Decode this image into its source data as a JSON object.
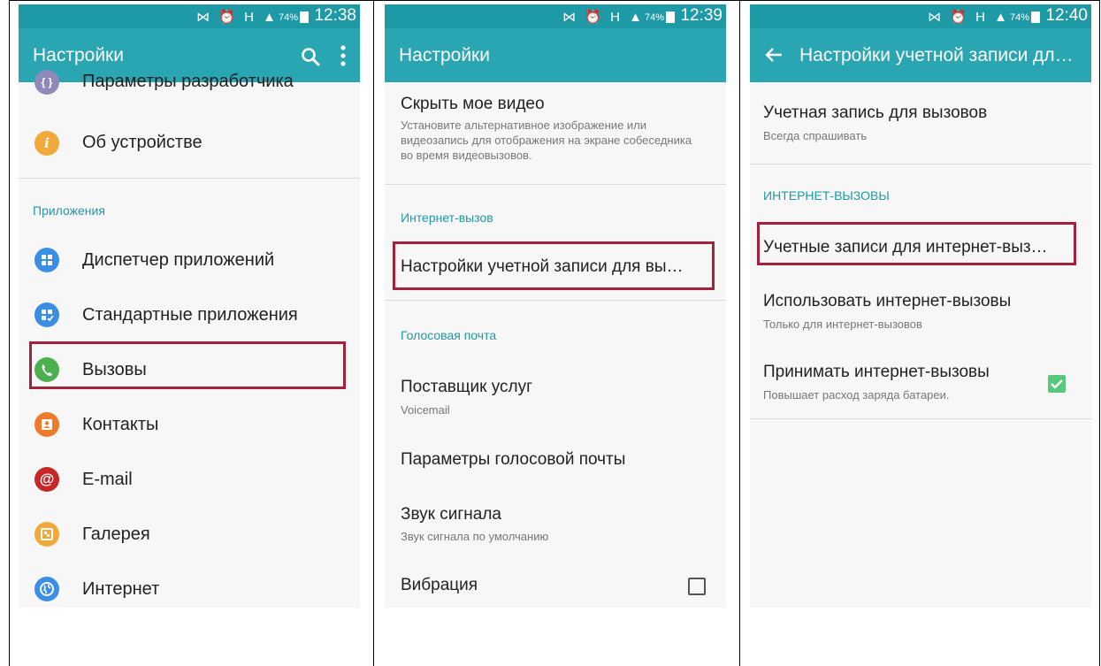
{
  "phone1": {
    "status": {
      "icons": "⋈ ⏰ H ▲",
      "battery": "74%",
      "time": "12:38"
    },
    "title": "Настройки",
    "top_partial_item": "Параметры разработчика",
    "about_item": "Об устройстве",
    "section": "Приложения",
    "items": [
      {
        "label": "Диспетчер приложений",
        "icon": "grid-icon",
        "color": "#3a8ee6"
      },
      {
        "label": "Стандартные приложения",
        "icon": "default-apps-icon",
        "color": "#3a8ee6"
      },
      {
        "label": "Вызовы",
        "icon": "phone-icon",
        "color": "#4caf50"
      },
      {
        "label": "Контакты",
        "icon": "contacts-icon",
        "color": "#f07a2c"
      },
      {
        "label": "E-mail",
        "icon": "email-icon",
        "color": "#c62828"
      },
      {
        "label": "Галерея",
        "icon": "gallery-icon",
        "color": "#f2a93b"
      },
      {
        "label": "Интернет",
        "icon": "globe-icon",
        "color": "#3a8ee6"
      }
    ]
  },
  "phone2": {
    "status": {
      "icons": "⋈ ⏰ H ▲",
      "battery": "74%",
      "time": "12:39"
    },
    "title": "Настройки",
    "hide_video": {
      "title": "Скрыть мое видео",
      "sub": "Установите альтернативное изображение или видеозапись для отображения на экране собеседника во время видеовызовов."
    },
    "section_internet": "Интернет-вызов",
    "account_settings": "Настройки учетной записи для вы…",
    "section_voicemail": "Голосовая почта",
    "provider": {
      "title": "Поставщик услуг",
      "sub": "Voicemail"
    },
    "voicemail_params": "Параметры голосовой почты",
    "ringtone": {
      "title": "Звук сигнала",
      "sub": "Звук сигнала по умолчанию"
    },
    "vibration": "Вибрация"
  },
  "phone3": {
    "status": {
      "icons": "⋈ ⏰ H ▲",
      "battery": "74%",
      "time": "12:40"
    },
    "title": "Настройки учетной записи дл…",
    "calls_account": {
      "title": "Учетная запись для вызовов",
      "sub": "Всегда спрашивать"
    },
    "section": "ИНТЕРНЕТ-ВЫЗОВЫ",
    "internet_accounts": "Учетные записи для интернет-выз…",
    "use_internet": {
      "title": "Использовать интернет-вызовы",
      "sub": "Только для интернет-вызовов"
    },
    "accept_internet": {
      "title": "Принимать интернет-вызовы",
      "sub": "Повышает расход заряда батареи.",
      "checked": true
    }
  },
  "colors": {
    "accent": "#2aa6b3",
    "highlight": "#a3213b",
    "section": "#1e9aa6"
  }
}
